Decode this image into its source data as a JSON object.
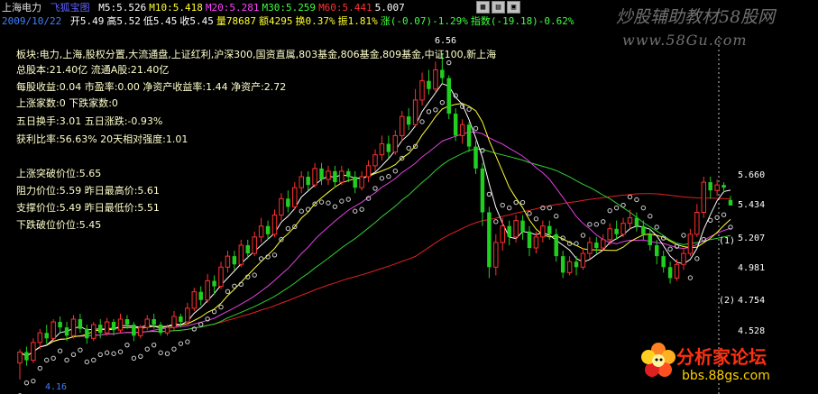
{
  "header": {
    "stock_name": "上海电力",
    "ai_label": "飞狐宝图",
    "ma": [
      {
        "label": "M5:5.526",
        "color": "#ffffff"
      },
      {
        "label": "M10:5.418",
        "color": "#ffff30"
      },
      {
        "label": "M20:5.281",
        "color": "#ff40ff"
      },
      {
        "label": "M30:5.259",
        "color": "#40ff40"
      },
      {
        "label": "M60:5.441",
        "color": "#ff3030"
      },
      {
        "label": "5.007",
        "color": "#ffffff"
      }
    ],
    "date": "2009/10/22",
    "quote": [
      {
        "label": "开5.49",
        "color": "#ffffff"
      },
      {
        "label": "高5.52",
        "color": "#ffffff"
      },
      {
        "label": "低5.45",
        "color": "#ffffff"
      },
      {
        "label": "收5.45",
        "color": "#ffffff"
      },
      {
        "label": "量78687",
        "color": "#ffff30"
      },
      {
        "label": "额4295",
        "color": "#ffff30"
      },
      {
        "label": "换0.37%",
        "color": "#ffff30"
      },
      {
        "label": "振1.81%",
        "color": "#ffff30"
      },
      {
        "label": "涨(-0.07)-1.29%",
        "color": "#40ff40"
      },
      {
        "label": "指数(-19.18)-0.62%",
        "color": "#40ff40"
      }
    ]
  },
  "watermark": {
    "site_cn": "炒股辅助教材58股网",
    "site_url": "www.58Gu.com"
  },
  "forum_logo": {
    "title": "分析家论坛",
    "url": "bbs.88gs.com"
  },
  "info_panel": [
    "板块:电力,上海,股权分置,大流通盘,上证红利,沪深300,国资直属,803基金,806基金,809基金,中证100,新上海",
    "总股本:21.40亿  流通A股:21.40亿",
    "每股收益:0.04  市盈率:0.00  净资产收益率:1.44  净资产:2.72",
    "上涨家数:0     下跌家数:0",
    "五日换手:3.01   五日涨跌:-0.93%",
    "获利比率:56.63%  20天相对强度:1.01",
    "上涨突破价位:5.65",
    "阻力价位:5.59  昨日最高价:5.61",
    "支撑价位:5.49  昨日最低价:5.51",
    "下跌破位价位:5.45"
  ],
  "y_axis": [
    "5.660",
    "5.434",
    "5.207",
    "4.981",
    "4.754",
    "4.528"
  ],
  "high_label": "6.56",
  "low_label": "4.16",
  "wave_markers": [
    "(1)",
    "(2)"
  ],
  "chart_data": {
    "type": "candlestick",
    "y_ticks": [
      5.66,
      5.434,
      5.207,
      4.981,
      4.754,
      4.528
    ],
    "high": 6.56,
    "low": 4.16,
    "candles": [
      [
        4.3,
        4.38,
        4.18,
        4.4
      ],
      [
        4.38,
        4.32,
        4.28,
        4.42
      ],
      [
        4.32,
        4.45,
        4.3,
        4.48
      ],
      [
        4.45,
        4.52,
        4.4,
        4.55
      ],
      [
        4.52,
        4.48,
        4.44,
        4.58
      ],
      [
        4.48,
        4.6,
        4.46,
        4.62
      ],
      [
        4.6,
        4.56,
        4.52,
        4.64
      ],
      [
        4.56,
        4.5,
        4.46,
        4.6
      ],
      [
        4.5,
        4.62,
        4.48,
        4.65
      ],
      [
        4.62,
        4.55,
        4.52,
        4.66
      ],
      [
        4.55,
        4.48,
        4.44,
        4.58
      ],
      [
        4.48,
        4.58,
        4.46,
        4.6
      ],
      [
        4.58,
        4.52,
        4.48,
        4.62
      ],
      [
        4.52,
        4.6,
        4.5,
        4.63
      ],
      [
        4.6,
        4.54,
        4.5,
        4.62
      ],
      [
        4.54,
        4.62,
        4.52,
        4.66
      ],
      [
        4.62,
        4.58,
        4.55,
        4.65
      ],
      [
        4.58,
        4.5,
        4.46,
        4.6
      ],
      [
        4.5,
        4.56,
        4.48,
        4.58
      ],
      [
        4.56,
        4.62,
        4.54,
        4.65
      ],
      [
        4.62,
        4.58,
        4.55,
        4.66
      ],
      [
        4.58,
        4.52,
        4.5,
        4.6
      ],
      [
        4.52,
        4.56,
        4.5,
        4.58
      ],
      [
        4.56,
        4.64,
        4.54,
        4.68
      ],
      [
        4.64,
        4.6,
        4.56,
        4.66
      ],
      [
        4.6,
        4.7,
        4.58,
        4.74
      ],
      [
        4.7,
        4.82,
        4.68,
        4.85
      ],
      [
        4.82,
        4.76,
        4.72,
        4.86
      ],
      [
        4.76,
        4.9,
        4.74,
        4.95
      ],
      [
        4.9,
        4.86,
        4.8,
        4.94
      ],
      [
        4.86,
        5.0,
        4.84,
        5.04
      ],
      [
        5.0,
        5.08,
        4.96,
        5.12
      ],
      [
        5.08,
        5.02,
        4.98,
        5.12
      ],
      [
        5.02,
        5.16,
        5.0,
        5.2
      ],
      [
        5.16,
        5.1,
        5.06,
        5.2
      ],
      [
        5.1,
        5.22,
        5.08,
        5.26
      ],
      [
        5.22,
        5.3,
        5.18,
        5.36
      ],
      [
        5.3,
        5.24,
        5.2,
        5.34
      ],
      [
        5.24,
        5.38,
        5.22,
        5.42
      ],
      [
        5.38,
        5.5,
        5.34,
        5.54
      ],
      [
        5.5,
        5.44,
        5.4,
        5.56
      ],
      [
        5.44,
        5.58,
        5.42,
        5.62
      ],
      [
        5.58,
        5.66,
        5.54,
        5.7
      ],
      [
        5.66,
        5.6,
        5.56,
        5.7
      ],
      [
        5.6,
        5.72,
        5.58,
        5.76
      ],
      [
        5.72,
        5.64,
        5.6,
        5.76
      ],
      [
        5.64,
        5.7,
        5.6,
        5.74
      ],
      [
        5.7,
        5.62,
        5.58,
        5.74
      ],
      [
        5.62,
        5.7,
        5.6,
        5.74
      ],
      [
        5.7,
        5.66,
        5.62,
        5.72
      ],
      [
        5.66,
        5.58,
        5.54,
        5.7
      ],
      [
        5.58,
        5.66,
        5.56,
        5.7
      ],
      [
        5.66,
        5.74,
        5.62,
        5.78
      ],
      [
        5.74,
        5.82,
        5.7,
        5.86
      ],
      [
        5.82,
        5.9,
        5.78,
        5.96
      ],
      [
        5.9,
        5.84,
        5.8,
        5.96
      ],
      [
        5.84,
        5.96,
        5.82,
        6.0
      ],
      [
        5.96,
        6.1,
        5.92,
        6.14
      ],
      [
        6.1,
        6.04,
        6.0,
        6.16
      ],
      [
        6.04,
        6.22,
        6.02,
        6.3
      ],
      [
        6.22,
        6.36,
        6.18,
        6.42
      ],
      [
        6.36,
        6.3,
        6.26,
        6.44
      ],
      [
        6.3,
        6.44,
        6.28,
        6.5
      ],
      [
        6.44,
        6.38,
        6.34,
        6.56
      ],
      [
        6.38,
        6.12,
        6.08,
        6.4
      ],
      [
        6.12,
        5.96,
        5.92,
        6.16
      ],
      [
        5.96,
        6.04,
        5.9,
        6.08
      ],
      [
        6.04,
        5.88,
        5.84,
        6.06
      ],
      [
        5.88,
        5.72,
        5.68,
        5.92
      ],
      [
        5.72,
        5.4,
        5.3,
        5.76
      ],
      [
        5.4,
        5.0,
        4.92,
        5.44
      ],
      [
        5.0,
        5.18,
        4.94,
        5.24
      ],
      [
        5.18,
        5.3,
        5.12,
        5.36
      ],
      [
        5.3,
        5.22,
        5.16,
        5.34
      ],
      [
        5.22,
        5.34,
        5.18,
        5.38
      ],
      [
        5.34,
        5.26,
        5.2,
        5.38
      ],
      [
        5.26,
        5.14,
        5.08,
        5.3
      ],
      [
        5.14,
        5.22,
        5.1,
        5.26
      ],
      [
        5.22,
        5.3,
        5.18,
        5.34
      ],
      [
        5.3,
        5.24,
        5.2,
        5.34
      ],
      [
        5.24,
        5.08,
        5.04,
        5.28
      ],
      [
        5.08,
        4.96,
        4.92,
        5.12
      ],
      [
        4.96,
        5.04,
        4.94,
        5.08
      ],
      [
        5.04,
        5.0,
        4.94,
        5.08
      ],
      [
        5.0,
        5.1,
        4.98,
        5.14
      ],
      [
        5.1,
        5.18,
        5.06,
        5.22
      ],
      [
        5.18,
        5.14,
        5.1,
        5.22
      ],
      [
        5.14,
        5.2,
        5.12,
        5.24
      ],
      [
        5.2,
        5.28,
        5.16,
        5.32
      ],
      [
        5.28,
        5.24,
        5.2,
        5.34
      ],
      [
        5.24,
        5.32,
        5.22,
        5.36
      ],
      [
        5.32,
        5.36,
        5.28,
        5.42
      ],
      [
        5.36,
        5.3,
        5.26,
        5.4
      ],
      [
        5.3,
        5.24,
        5.2,
        5.34
      ],
      [
        5.24,
        5.16,
        5.12,
        5.28
      ],
      [
        5.16,
        5.08,
        5.02,
        5.2
      ],
      [
        5.08,
        5.0,
        4.96,
        5.12
      ],
      [
        5.0,
        4.92,
        4.88,
        5.04
      ],
      [
        4.92,
        5.02,
        4.9,
        5.06
      ],
      [
        5.02,
        5.1,
        4.98,
        5.14
      ],
      [
        5.1,
        5.24,
        5.08,
        5.28
      ],
      [
        5.24,
        5.4,
        5.22,
        5.46
      ],
      [
        5.4,
        5.62,
        5.36,
        5.66
      ],
      [
        5.62,
        5.56,
        5.5,
        5.66
      ],
      [
        5.56,
        5.6,
        5.52,
        5.64
      ],
      [
        5.6,
        5.58,
        5.54,
        5.62
      ],
      [
        5.49,
        5.45,
        5.45,
        5.52
      ]
    ]
  }
}
